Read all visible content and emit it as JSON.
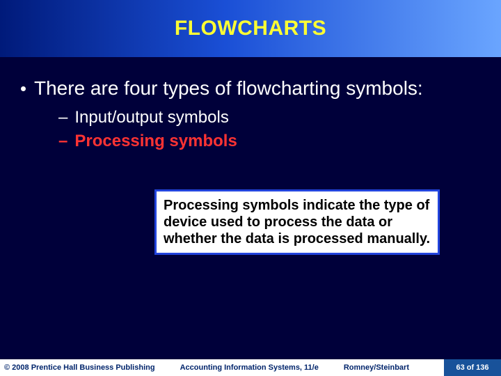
{
  "title": "FLOWCHARTS",
  "main_bullet": "There are four types of flowcharting symbols:",
  "sub_items": [
    {
      "text": "Input/output symbols",
      "highlight": false
    },
    {
      "text": "Processing symbols",
      "highlight": true
    }
  ],
  "callout": "Processing symbols indicate the type of device used to process the data or whether the data is processed manually.",
  "footer": {
    "copyright": "© 2008 Prentice Hall Business Publishing",
    "book": "Accounting Information Systems, 11/e",
    "authors": "Romney/Steinbart",
    "page": "63 of 136"
  }
}
